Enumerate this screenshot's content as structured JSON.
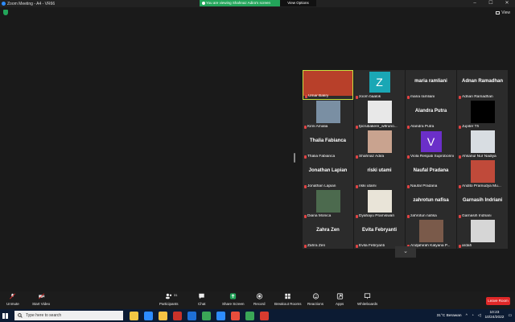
{
  "window": {
    "title": "Zoom Meeting - A4 - VR66"
  },
  "share_banner": {
    "text": "You are viewing Shahnaz Adira's screen",
    "view_options": "View Options"
  },
  "view_label": "View",
  "participants": [
    {
      "name": "Umar Bakry",
      "tile_type": "video",
      "active": true,
      "bg": "#b8402a"
    },
    {
      "name": "zoom baalok",
      "tile_type": "avatar",
      "avatar": "Z",
      "avatar_color": "#1aa7b5"
    },
    {
      "name": "maria ramliani",
      "tile_type": "name"
    },
    {
      "name": "Adnan Ramadhan",
      "tile_type": "name"
    },
    {
      "name": "Kirei Amalia",
      "tile_type": "video",
      "bg": "#7a8fa3"
    },
    {
      "name": "fpcrubakere_w8runo...",
      "tile_type": "video",
      "bg": "#e8e8e8"
    },
    {
      "name": "Alandra Putra",
      "tile_type": "name"
    },
    {
      "name": "Jupiter Th",
      "tile_type": "video",
      "bg": "#000000"
    },
    {
      "name": "Thalia Fabianca",
      "tile_type": "name"
    },
    {
      "name": "Shahnaz Adira",
      "tile_type": "video",
      "bg": "#c9a38f"
    },
    {
      "name": "Viola Respati Suproborini",
      "tile_type": "avatar",
      "avatar": "V",
      "avatar_color": "#6b2fc9"
    },
    {
      "name": "Ahsanul Nur Nadiya",
      "tile_type": "video",
      "bg": "#d8dde2"
    },
    {
      "name": "Jonathan Lapian",
      "tile_type": "name"
    },
    {
      "name": "riski utami",
      "tile_type": "name"
    },
    {
      "name": "Naufal Pradana",
      "tile_type": "name"
    },
    {
      "name": "Andito Pramudya Mu...",
      "tile_type": "video",
      "bg": "#c04a3a"
    },
    {
      "name": "Diana Monica",
      "tile_type": "video",
      "bg": "#4c6a4e"
    },
    {
      "name": "Dyahayu Pramiswari",
      "tile_type": "video",
      "bg": "#e9e4d8"
    },
    {
      "name": "zahrotun nafisa",
      "tile_type": "name"
    },
    {
      "name": "Garnasih Indriani",
      "tile_type": "name"
    },
    {
      "name": "Zahra Zen",
      "tile_type": "name"
    },
    {
      "name": "Evita Febryanti",
      "tile_type": "name"
    },
    {
      "name": "Andjahirah Kalyana P...",
      "tile_type": "video",
      "bg": "#7a5a4a"
    },
    {
      "name": "ardah",
      "tile_type": "video",
      "bg": "#d6d6d6"
    }
  ],
  "toolbar": {
    "unmute": "Unmute",
    "start_video": "Start Video",
    "participants": "Participants",
    "participants_count": "31",
    "chat": "Chat",
    "share_screen": "Share Screen",
    "record": "Record",
    "breakout": "Breakout Rooms",
    "reactions": "Reactions",
    "apps": "Apps",
    "whiteboards": "Whiteboards",
    "leave": "Leave Room"
  },
  "taskbar": {
    "search_placeholder": "Type here to search",
    "weather": "31°C  Berawan",
    "time": "10:23",
    "date": "10/24/2022"
  },
  "colors": {
    "active_border": "#c6e040",
    "share_green": "#23a55a",
    "leave_red": "#e02828",
    "taskbar": "#0c1b33"
  }
}
